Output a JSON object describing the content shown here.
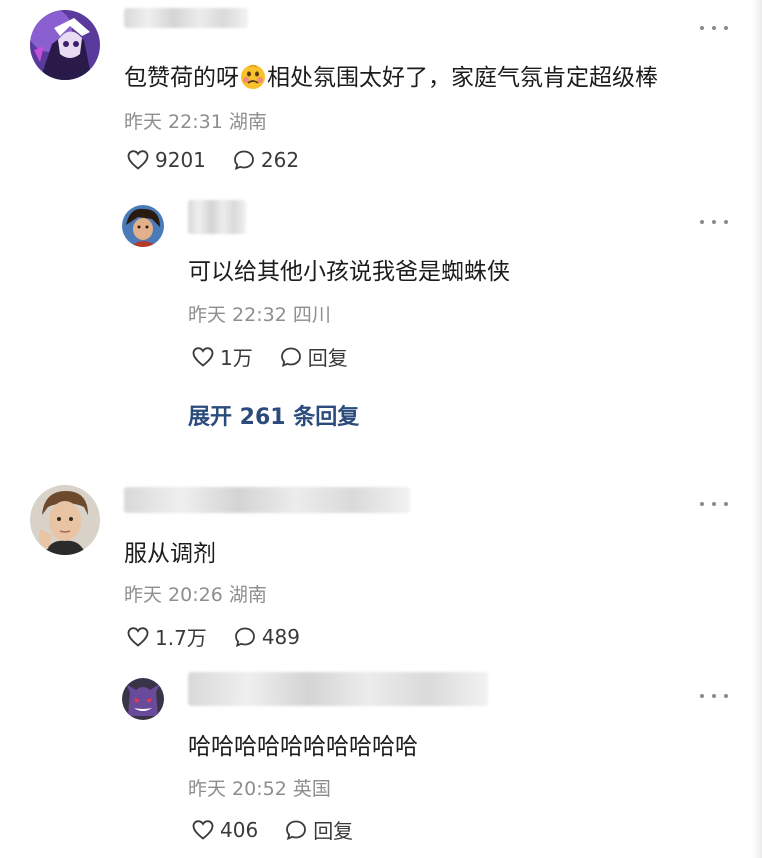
{
  "comments": [
    {
      "text_before": "包赞荷的呀",
      "emoji": "woozy-face-emoji",
      "text_after": "相处氛围太好了，家庭气氛肯定超级棒",
      "meta": "昨天 22:31 湖南",
      "likes": "9201",
      "replies": "262",
      "reply": {
        "text": "可以给其他小孩说我爸是蜘蛛侠",
        "meta": "昨天 22:32 四川",
        "likes": "1万",
        "reply_label": "回复"
      },
      "expand_label": "展开 261 条回复"
    },
    {
      "text": "服从调剂",
      "meta": "昨天 20:26 湖南",
      "likes": "1.7万",
      "replies": "489",
      "reply": {
        "text": "哈哈哈哈哈哈哈哈哈哈",
        "meta": "昨天 20:52 英国",
        "likes": "406",
        "reply_label": "回复"
      }
    }
  ],
  "icons": {
    "like": "heart-outline-icon",
    "comment": "speech-bubble-icon",
    "more": "more-horizontal-icon"
  },
  "colors": {
    "expand_link": "#2a4b7c",
    "meta": "#8e8e8e"
  }
}
